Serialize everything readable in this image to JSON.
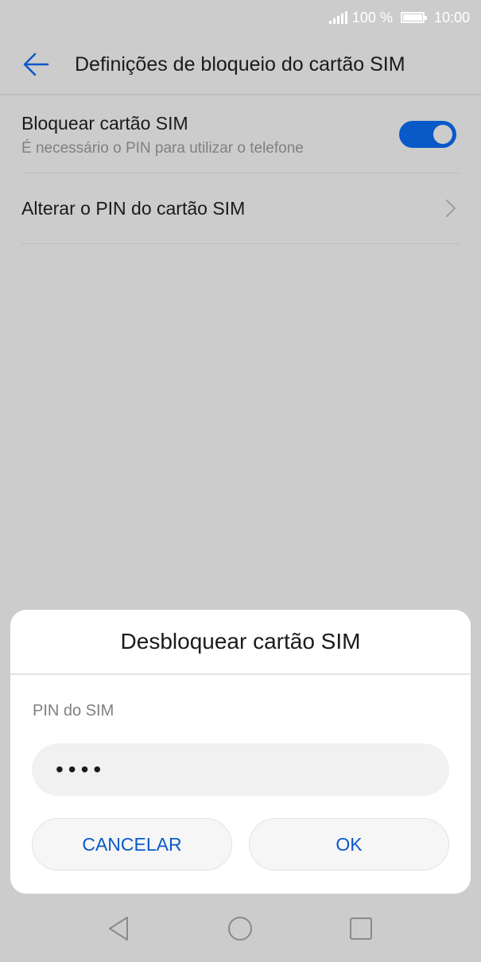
{
  "status_bar": {
    "signal_icon": "signal-icon",
    "battery_text": "100 %",
    "battery_icon": "battery-icon",
    "time": "10:00"
  },
  "app_bar": {
    "back_icon": "back-arrow-icon",
    "title": "Definições de bloqueio do cartão SIM"
  },
  "settings": {
    "lock_sim": {
      "title": "Bloquear cartão SIM",
      "subtitle": "É necessário o PIN para utilizar o telefone",
      "toggle_on": true
    },
    "change_pin": {
      "title": "Alterar o PIN do cartão SIM",
      "chevron_icon": "chevron-right-icon"
    }
  },
  "dialog": {
    "title": "Desbloquear cartão SIM",
    "pin_label": "PIN do SIM",
    "pin_value": "••••",
    "cancel_label": "CANCELAR",
    "ok_label": "OK"
  },
  "nav_bar": {
    "back": "nav-back-icon",
    "home": "nav-home-icon",
    "recents": "nav-recents-icon"
  },
  "colors": {
    "accent": "#0a59c9",
    "background": "#cccccc",
    "dialog": "#ffffff"
  }
}
